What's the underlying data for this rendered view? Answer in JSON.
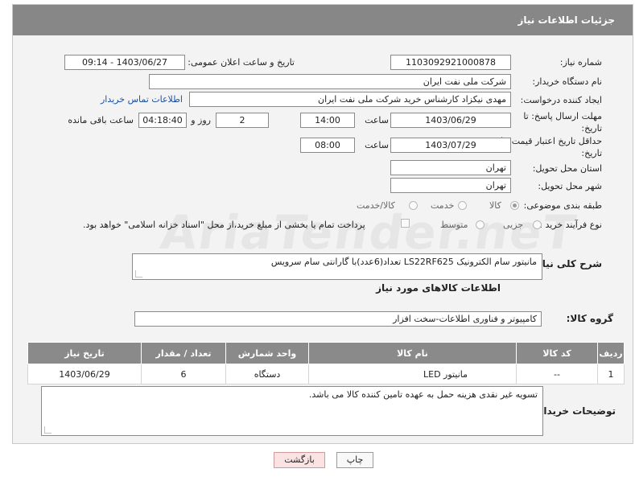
{
  "header": {
    "title": "جزئیات اطلاعات نیاز"
  },
  "labels": {
    "need_number": "شماره نیاز:",
    "announce_datetime": "تاریخ و ساعت اعلان عمومی:",
    "buyer_org": "نام دستگاه خریدار:",
    "creator": "ایجاد کننده درخواست:",
    "reply_deadline": "مهلت ارسال پاسخ: تا تاریخ:",
    "price_validity": "حداقل تاریخ اعتبار قیمت: تا تاریخ:",
    "time_word": "ساعت",
    "day_word": "روز و",
    "remaining": "ساعت باقی مانده",
    "province": "استان محل تحویل:",
    "city": "شهر محل تحویل:",
    "category": "طبقه بندی موضوعی:",
    "process": "نوع فرآیند خرید :",
    "description": "شرح کلی نیاز:",
    "goods_info": "اطلاعات کالاهای مورد نیاز",
    "goods_group": "گروه کالا:",
    "buyer_notes": "توضیحات خریدار:"
  },
  "fields": {
    "need_number": "1103092921000878",
    "announce_datetime": "1403/06/27 - 09:14",
    "buyer_org": "شرکت ملی نفت ایران",
    "creator": "مهدی نیکزاد کارشناس خرید شرکت ملی نفت ایران",
    "contact_link": "اطلاعات تماس خریدار",
    "reply_date": "1403/06/29",
    "reply_time": "14:00",
    "reply_days": "2",
    "reply_remaining": "04:18:40",
    "validity_date": "1403/07/29",
    "validity_time": "08:00",
    "province": "تهران",
    "city": "تهران",
    "description": "مانیتور سام الکترونیک  LS22RF625  تعداد(6عدد)با گارانتی سام سرویس",
    "goods_group": "کامپیوتر و فناوری اطلاعات-سخت افزار",
    "buyer_notes": "تسویه غیر نقدی هزینه حمل به عهده تامین کننده کالا می باشد."
  },
  "category_options": [
    {
      "label": "کالا",
      "selected": true
    },
    {
      "label": "خدمت",
      "selected": false
    },
    {
      "label": "کالا/خدمت",
      "selected": false
    }
  ],
  "process_options": [
    {
      "label": "جزیی",
      "selected": false
    },
    {
      "label": "متوسط",
      "selected": false
    }
  ],
  "payment_note": "پرداخت تمام یا بخشی از مبلغ خرید،از محل \"اسناد خزانه اسلامی\" خواهد بود.",
  "table": {
    "headers": [
      "ردیف",
      "کد کالا",
      "نام کالا",
      "واحد شمارش",
      "تعداد / مقدار",
      "تاریخ نیاز"
    ],
    "rows": [
      [
        "1",
        "--",
        "مانیتور LED",
        "دستگاه",
        "6",
        "1403/06/29"
      ]
    ]
  },
  "buttons": {
    "print": "چاپ",
    "back": "بازگشت"
  },
  "watermark": "AriaTender.neT"
}
